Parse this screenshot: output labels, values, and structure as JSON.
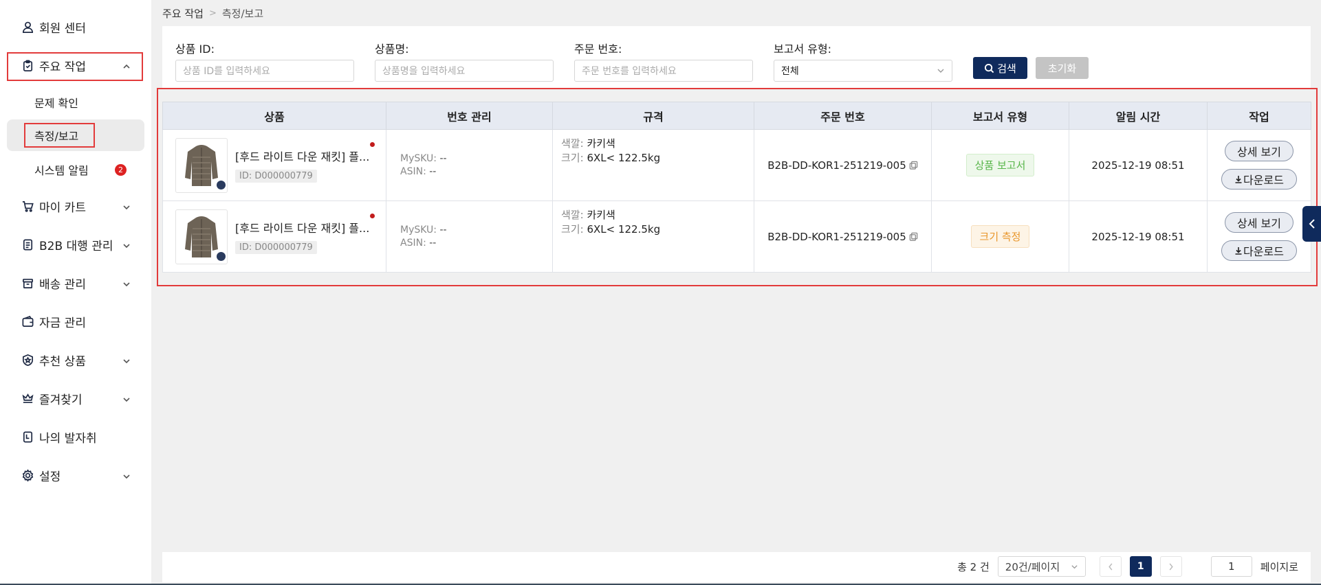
{
  "sidebar": {
    "items": [
      {
        "label": "회원 센터",
        "icon": "user-icon"
      },
      {
        "label": "주요 작업",
        "icon": "clipboard-icon"
      },
      {
        "label": "마이 카트",
        "icon": "cart-icon"
      },
      {
        "label": "B2B 대행 관리",
        "icon": "document-icon"
      },
      {
        "label": "배송 관리",
        "icon": "box-icon"
      },
      {
        "label": "자금 관리",
        "icon": "wallet-icon"
      },
      {
        "label": "추천 상품",
        "icon": "shield-star-icon"
      },
      {
        "label": "즐겨찾기",
        "icon": "heart-icon"
      },
      {
        "label": "나의 발자취",
        "icon": "footprint-icon"
      },
      {
        "label": "설정",
        "icon": "gear-icon"
      }
    ],
    "sub_items": [
      {
        "label": "문제 확인"
      },
      {
        "label": "측정/보고"
      },
      {
        "label": "시스템 알림",
        "badge": "2"
      }
    ]
  },
  "breadcrumb": {
    "root": "주요 작업",
    "sep": ">",
    "current": "측정/보고"
  },
  "filters": {
    "product_id": {
      "label": "상품 ID:",
      "placeholder": "상품 ID를 입력하세요"
    },
    "product_name": {
      "label": "상품명:",
      "placeholder": "상품명을 입력하세요"
    },
    "order_no": {
      "label": "주문 번호:",
      "placeholder": "주문 번호를 입력하세요"
    },
    "report_type": {
      "label": "보고서 유형:",
      "value": "전체"
    },
    "search_label": "검색",
    "reset_label": "초기화"
  },
  "table": {
    "headers": [
      "상품",
      "번호 관리",
      "규격",
      "주문 번호",
      "보고서 유형",
      "알림 시간",
      "작업"
    ],
    "rows": [
      {
        "name": "[후드 라이트 다운 재킷] 플...",
        "id": "ID: D000000779",
        "mysku_label": "MySKU:",
        "mysku": "--",
        "asin_label": "ASIN:",
        "asin": "--",
        "color_label": "색깔:",
        "color": "카키색",
        "size_label": "크기:",
        "size": "6XL< 122.5kg",
        "order_no": "B2B-DD-KOR1-251219-005",
        "report_type": "상품 보고서",
        "report_color": "#56b548",
        "time": "2025-12-19 08:51",
        "detail_label": "상세 보기",
        "download_label": "다운로드"
      },
      {
        "name": "[후드 라이트 다운 재킷] 플...",
        "id": "ID: D000000779",
        "mysku_label": "MySKU:",
        "mysku": "--",
        "asin_label": "ASIN:",
        "asin": "--",
        "color_label": "색깔:",
        "color": "카키색",
        "size_label": "크기:",
        "size": "6XL< 122.5kg",
        "order_no": "B2B-DD-KOR1-251219-005",
        "report_type": "크기 측정",
        "report_color": "#e9962a",
        "time": "2025-12-19 08:51",
        "detail_label": "상세 보기",
        "download_label": "다운로드"
      }
    ]
  },
  "pagination": {
    "total": "총 2 건",
    "page_size": "20건/페이지",
    "current_page": "1",
    "jump_value": "1",
    "jump_label": "페이지로"
  },
  "colors": {
    "accent": "#0f2a5c",
    "highlight_box": "#e23a3a"
  }
}
